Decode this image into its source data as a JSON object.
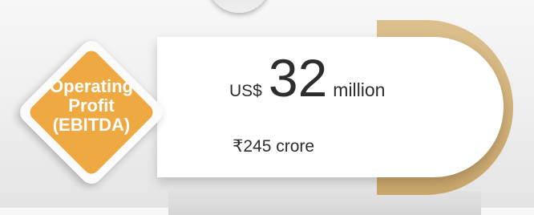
{
  "badge": {
    "lines": [
      "Operating",
      "Profit",
      "(EBITDA)"
    ]
  },
  "metric": {
    "currency_prefix": "US$",
    "value": "32",
    "unit": "million",
    "secondary_value": "₹245 crore"
  },
  "colors": {
    "badge_fill": "#eea943",
    "arc_gold": "#d4b37b",
    "card_background": "#ffffff",
    "text_dark": "#2d2d2d"
  }
}
